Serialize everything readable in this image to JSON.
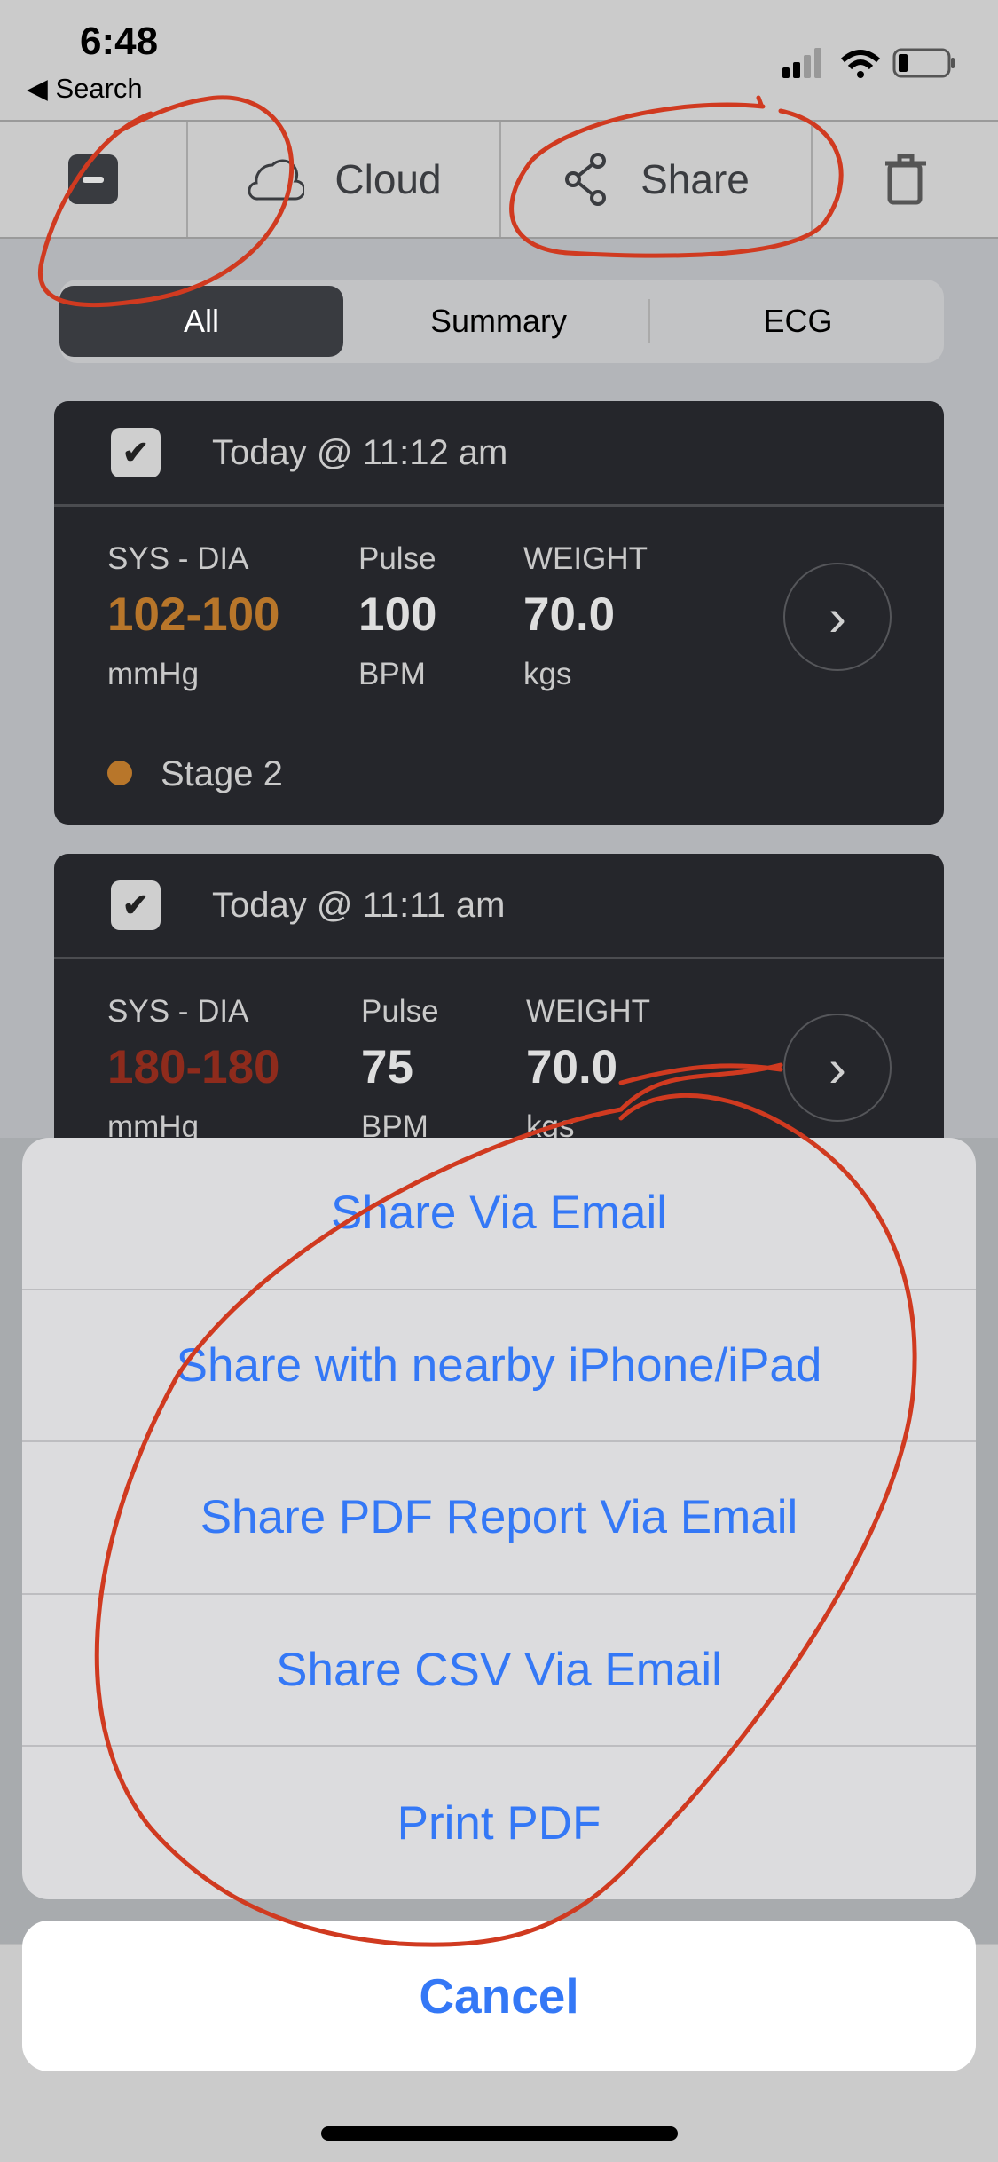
{
  "status_bar": {
    "time": "6:48",
    "back_label": "Search"
  },
  "toolbar": {
    "cloud_label": "Cloud",
    "share_label": "Share"
  },
  "segments": {
    "items": [
      "All",
      "Summary",
      "ECG"
    ],
    "selected": "All"
  },
  "readings": [
    {
      "date": "Today @ 11:12 am",
      "sys_dia_label": "SYS - DIA",
      "sys": "102",
      "dia": "100",
      "bp_color": "#b8762a",
      "bp_unit": "mmHg",
      "pulse_label": "Pulse",
      "pulse": "100",
      "pulse_unit": "BPM",
      "weight_label": "WEIGHT",
      "weight": "70.0",
      "weight_unit": "kgs",
      "stage": "Stage 2",
      "stage_color": "#b8762a",
      "checked": true
    },
    {
      "date": "Today @ 11:11 am",
      "sys_dia_label": "SYS - DIA",
      "sys": "180",
      "dia": "180",
      "bp_color": "#8e2b1c",
      "bp_unit": "mmHg",
      "pulse_label": "Pulse",
      "pulse": "75",
      "pulse_unit": "BPM",
      "weight_label": "WEIGHT",
      "weight": "70.0",
      "weight_unit": "kgs",
      "checked": true
    }
  ],
  "action_sheet": {
    "options": [
      "Share Via Email",
      "Share with nearby iPhone/iPad",
      "Share PDF Report Via Email",
      "Share CSV Via Email",
      "Print PDF"
    ],
    "cancel": "Cancel",
    "accent": "#3478f6"
  },
  "annotation_color": "#d03a20"
}
